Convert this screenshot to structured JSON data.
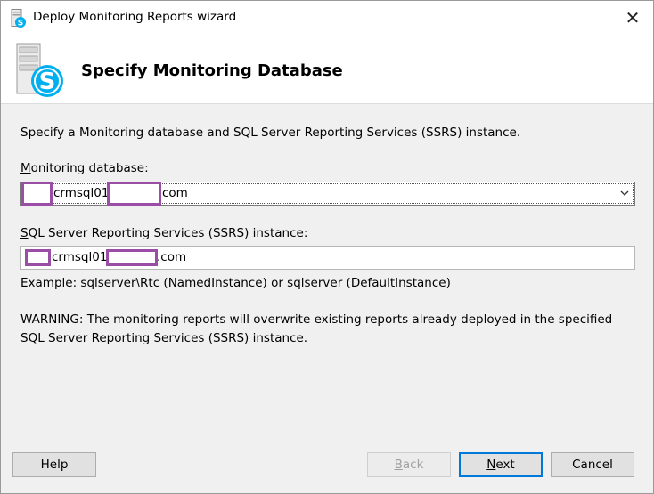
{
  "window": {
    "title": "Deploy Monitoring Reports wizard",
    "close_glyph": "✕"
  },
  "header": {
    "title": "Specify Monitoring Database"
  },
  "content": {
    "description": "Specify a Monitoring database and SQL Server Reporting Services (SSRS) instance.",
    "monitoring_db_label_accel": "M",
    "monitoring_db_label_rest": "onitoring database:",
    "monitoring_db_value_part1": "crmsql01",
    "monitoring_db_value_part2": "com",
    "ssrs_label_accel": "S",
    "ssrs_label_rest": "QL Server Reporting Services (SSRS) instance:",
    "ssrs_value_part1": "crmsql01",
    "ssrs_value_part2": ".com",
    "example": "Example: sqlserver\\Rtc (NamedInstance) or sqlserver (DefaultInstance)",
    "warning": "WARNING: The monitoring reports will overwrite existing reports already deployed in the specified SQL Server Reporting Services (SSRS) instance."
  },
  "buttons": {
    "help": "Help",
    "back_accel": "B",
    "back_rest": "ack",
    "next_accel": "N",
    "next_rest": "ext",
    "cancel": "Cancel"
  },
  "colors": {
    "redaction": "#9b4ea6",
    "skype_blue": "#00aff0",
    "focus_border": "#0078d7"
  }
}
